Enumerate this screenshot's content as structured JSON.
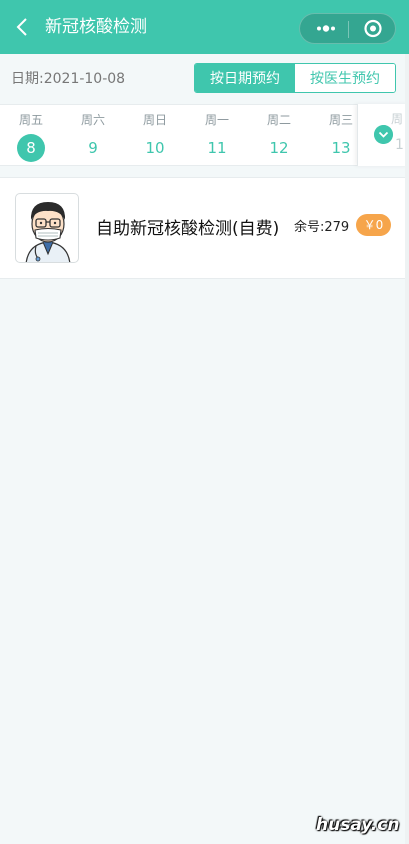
{
  "header": {
    "title": "新冠核酸检测",
    "back_icon": "chevron-left-icon",
    "menu_icon": "more-dots-icon",
    "close_icon": "target-circle-icon",
    "background_color": "#3fc6ad"
  },
  "date_bar": {
    "date_text": "日期:2021-10-08",
    "tabs": [
      {
        "label": "按日期预约",
        "active": true
      },
      {
        "label": "按医生预约",
        "active": false
      }
    ]
  },
  "week": {
    "days": [
      {
        "weekday": "周五",
        "date": "8",
        "selected": true
      },
      {
        "weekday": "周六",
        "date": "9",
        "selected": false
      },
      {
        "weekday": "周日",
        "date": "10",
        "selected": false
      },
      {
        "weekday": "周一",
        "date": "11",
        "selected": false
      },
      {
        "weekday": "周二",
        "date": "12",
        "selected": false
      },
      {
        "weekday": "周三",
        "date": "13",
        "selected": false
      }
    ],
    "partial_next": {
      "weekday": "周",
      "date": "1"
    },
    "expand_icon": "chevron-down-icon"
  },
  "service": {
    "name": "自助新冠核酸检测(自费)",
    "remaining": "余号:279",
    "price": "￥0",
    "avatar_icon": "doctor-avatar-icon",
    "price_color": "#f6a54b"
  },
  "watermark": "husay.cn"
}
